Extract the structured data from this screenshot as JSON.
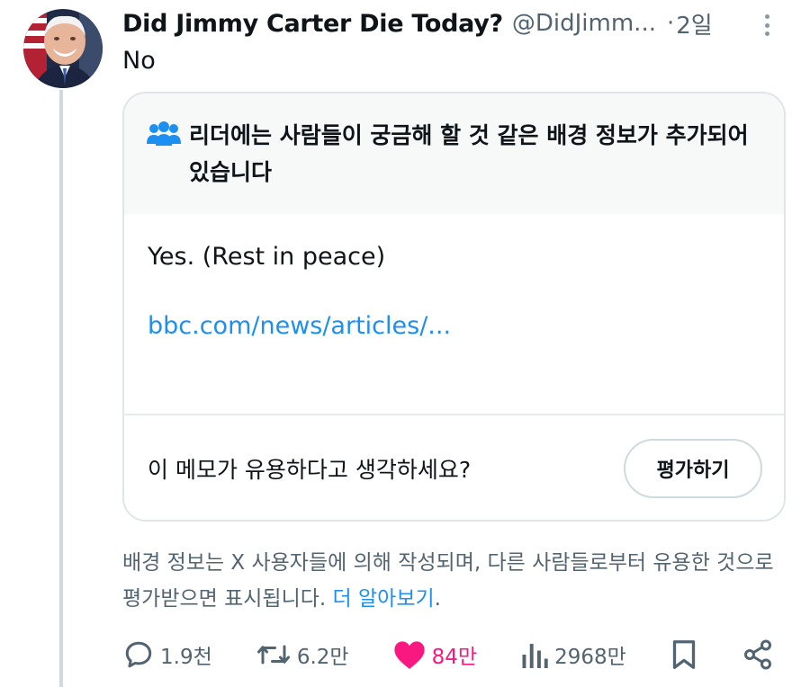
{
  "tweet": {
    "display_name": "Did Jimmy Carter Die Today?",
    "handle": "@DidJimm...",
    "separator": "·",
    "timestamp": "2일",
    "text": "No"
  },
  "note": {
    "header": "리더에는 사람들이 궁금해 할 것 같은 배경 정보가 추가되어 있습니다",
    "body": "Yes. (Rest in peace)",
    "link": "bbc.com/news/articles/...",
    "question": "이 메모가 유용하다고 생각하세요?",
    "rate_label": "평가하기"
  },
  "disclaimer": {
    "text": "배경 정보는 X 사용자들에 의해 작성되며, 다른 사람들로부터 유용한 것으로 평가받으면 표시됩니다. ",
    "learn_more": "더 알아보기",
    "period": "."
  },
  "actions": {
    "replies": "1.9천",
    "reposts": "6.2만",
    "likes": "84만",
    "views": "2968만"
  },
  "colors": {
    "link": "#1d8ff0",
    "like": "#f91880",
    "secondary_text": "#536471",
    "note_header_bg": "#f7f9f9"
  },
  "icons": {
    "more": "more-vertical-icon",
    "note": "people-icon",
    "reply": "reply-icon",
    "repost": "repost-icon",
    "like": "heart-icon",
    "views": "views-icon",
    "bookmark": "bookmark-icon",
    "share": "share-icon"
  }
}
